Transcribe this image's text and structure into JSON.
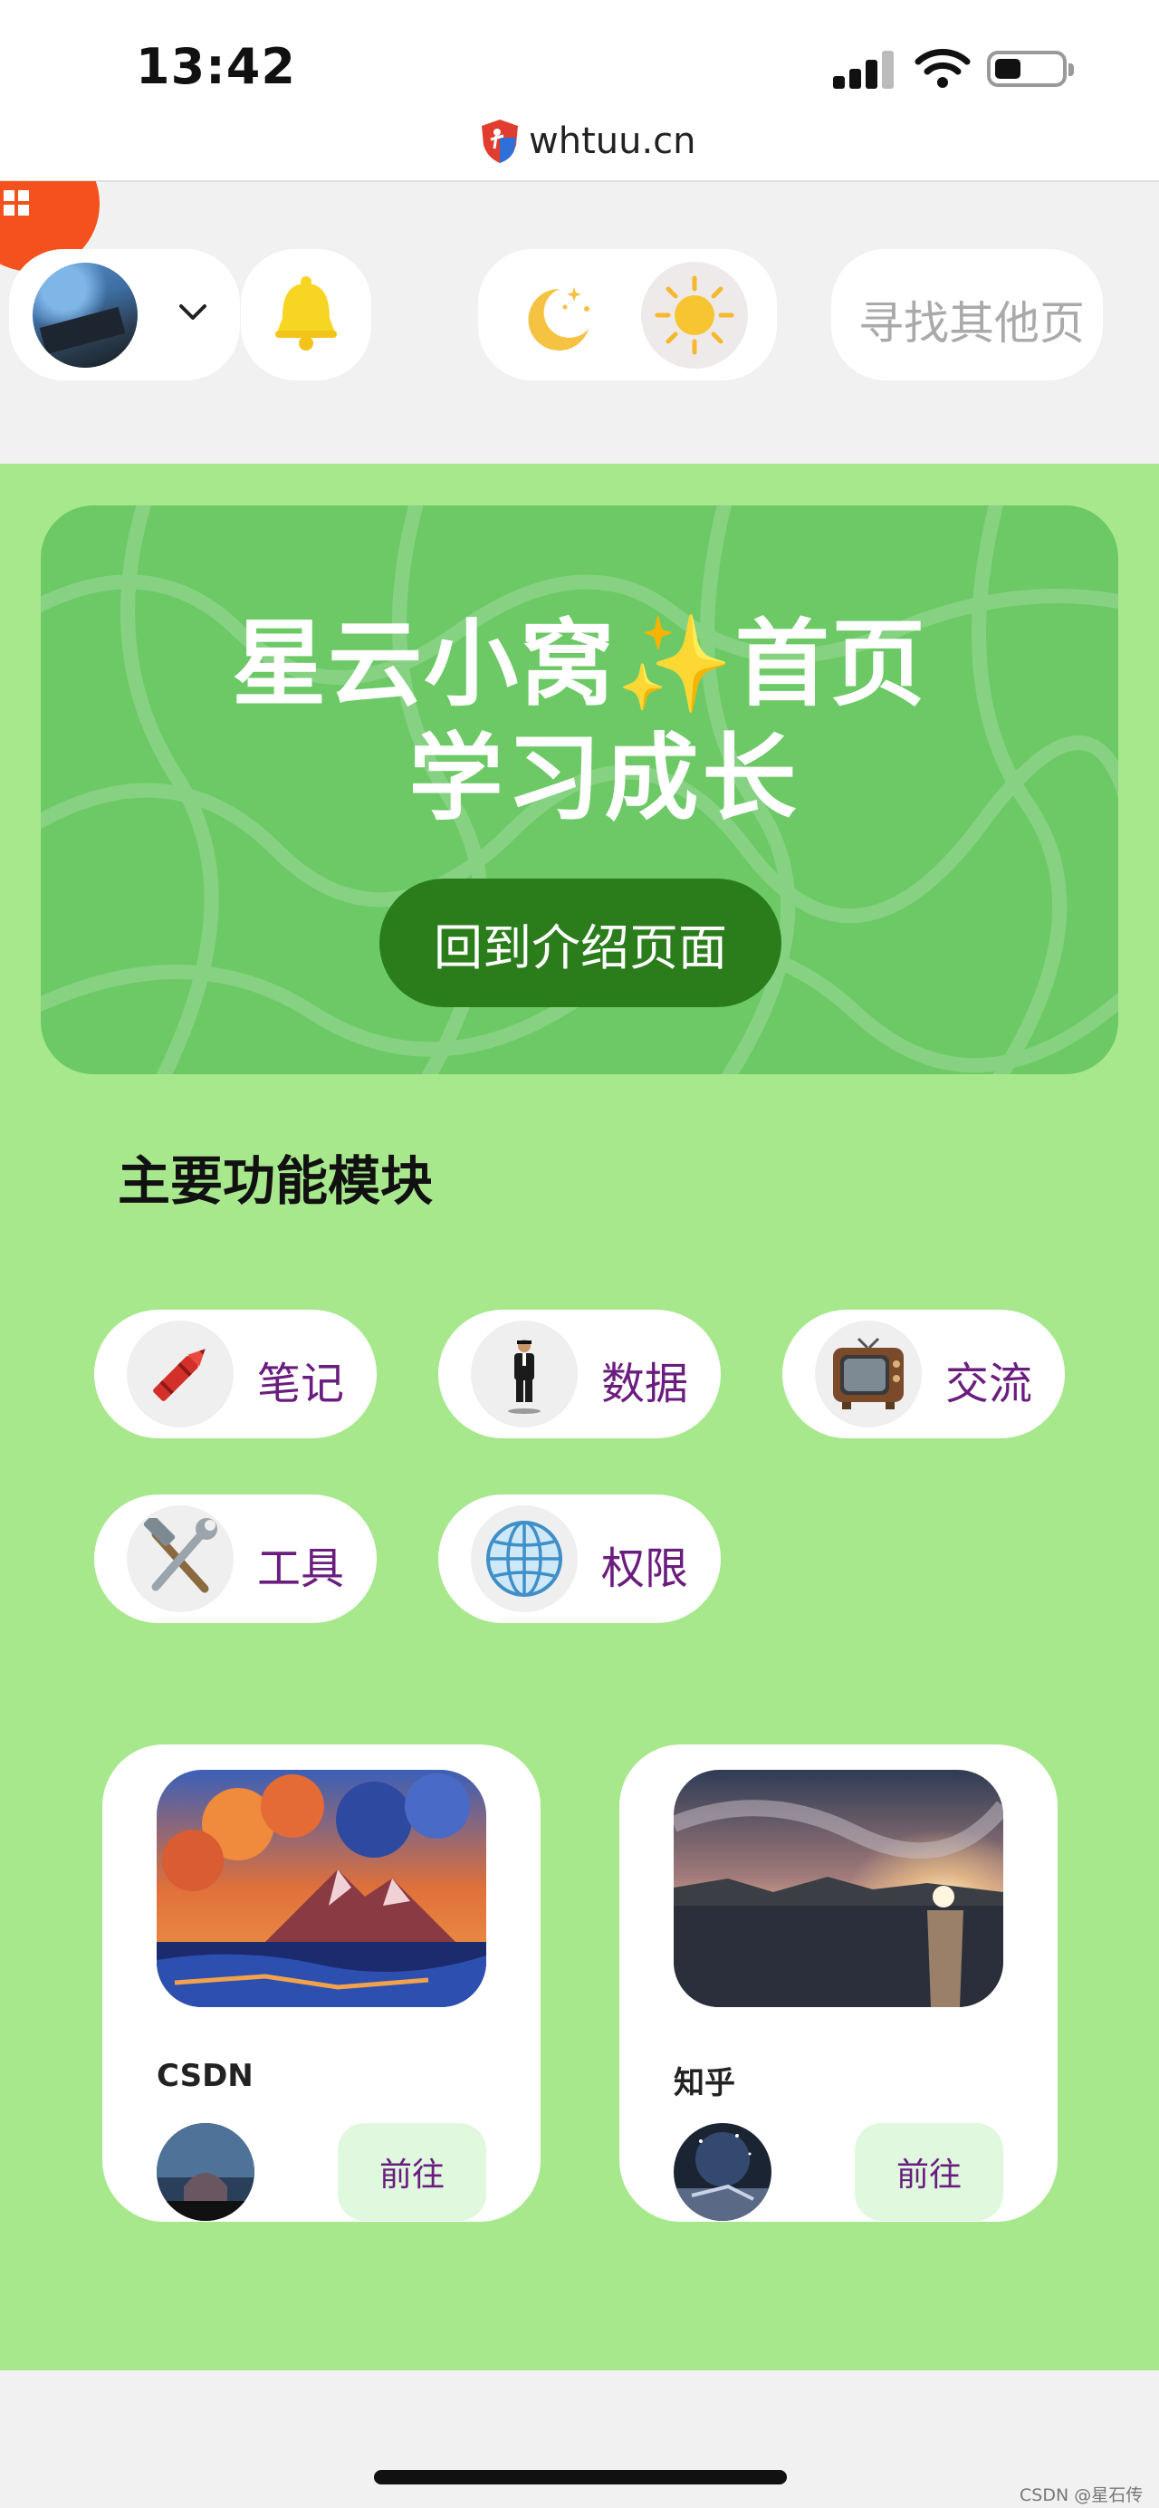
{
  "status_bar": {
    "time": "13:42",
    "url": "whtuu.cn"
  },
  "nav": {
    "search_placeholder": "寻找其他页"
  },
  "hero": {
    "title_line1": "星云小窝✨首页",
    "title_line2": "学习成长",
    "button_label": "回到介绍页面"
  },
  "section": {
    "title": "主要功能模块"
  },
  "features": [
    {
      "label": "笔记",
      "icon": "crayon-icon"
    },
    {
      "label": "数据",
      "icon": "levitating-man-icon"
    },
    {
      "label": "交流",
      "icon": "television-icon"
    },
    {
      "label": "工具",
      "icon": "hammer-wrench-icon"
    },
    {
      "label": "权限",
      "icon": "globe-icon"
    }
  ],
  "cards": [
    {
      "name": "CSDN",
      "button": "前往"
    },
    {
      "name": "知乎",
      "button": "前往"
    }
  ],
  "watermark": "CSDN @星石传说",
  "colors": {
    "main_bg": "#a8e88d",
    "hero_bg": "#6cc966",
    "hero_button": "#2b7d1b",
    "feature_label": "#6a1d7e",
    "go_button_bg": "#dff8de",
    "fab": "#f4511e"
  }
}
